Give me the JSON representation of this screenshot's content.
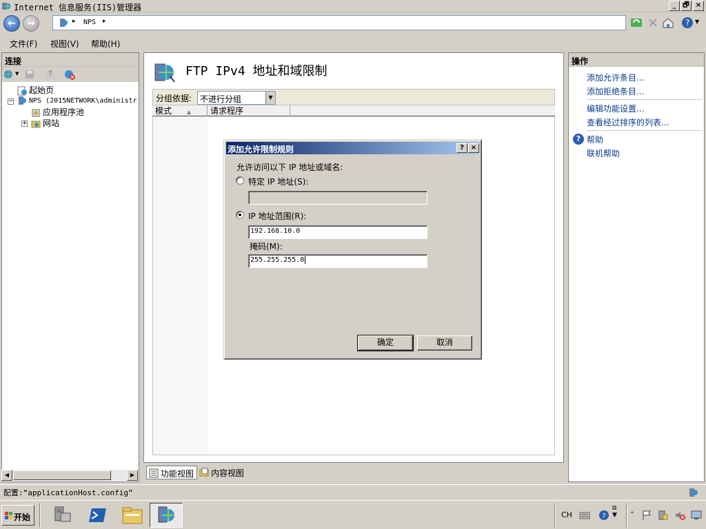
{
  "window": {
    "title": "Internet 信息服务(IIS)管理器",
    "min_glyph": "_",
    "max_glyph": "🗗",
    "close_glyph": "×"
  },
  "address": {
    "crumb": "NPS",
    "sep": "▸"
  },
  "menu": [
    {
      "label": "文件(F)"
    },
    {
      "label": "视图(V)"
    },
    {
      "label": "帮助(H)"
    }
  ],
  "left_panel": {
    "title": "连接",
    "tree": [
      {
        "label": "起始页",
        "expander": ""
      },
      {
        "label": "NPS (2015NETWORK\\administr",
        "expander": "−"
      },
      {
        "label": "应用程序池",
        "expander": ""
      },
      {
        "label": "网站",
        "expander": "+"
      }
    ]
  },
  "center": {
    "title": "FTP IPv4 地址和域限制",
    "group_label": "分组依据:",
    "group_value": "不进行分组",
    "col_mode": "模式",
    "col_requester": "请求程序",
    "tabs": [
      {
        "label": "功能视图",
        "active": true
      },
      {
        "label": "内容视图",
        "active": false
      }
    ]
  },
  "right_panel": {
    "title": "操作",
    "actions": [
      "添加允许条目...",
      "添加拒绝条目...",
      "编辑功能设置...",
      "查看经过排序的列表...",
      "帮助",
      "联机帮助"
    ]
  },
  "dialog": {
    "title": "添加允许限制规则",
    "help_glyph": "?",
    "close_glyph": "×",
    "prompt": "允许访问以下 IP 地址或域名:",
    "radio_specific": "特定 IP 地址(S):",
    "specific_value": "",
    "specific_checked": false,
    "radio_range": "IP 地址范围(R):",
    "range_checked": true,
    "range_value": "192.168.10.0",
    "mask_label": "掩码(M):",
    "mask_value": "255.255.255.0",
    "ok": "确定",
    "cancel": "取消"
  },
  "status": {
    "text": "配置:“applicationHost.config”"
  },
  "taskbar": {
    "start": "开始",
    "lang": "CH"
  },
  "colors": {
    "title_gradient_start": "#0a246a",
    "title_gradient_end": "#a6caf0",
    "link": "#0b3b8c",
    "chrome": "#d4d0c8"
  }
}
